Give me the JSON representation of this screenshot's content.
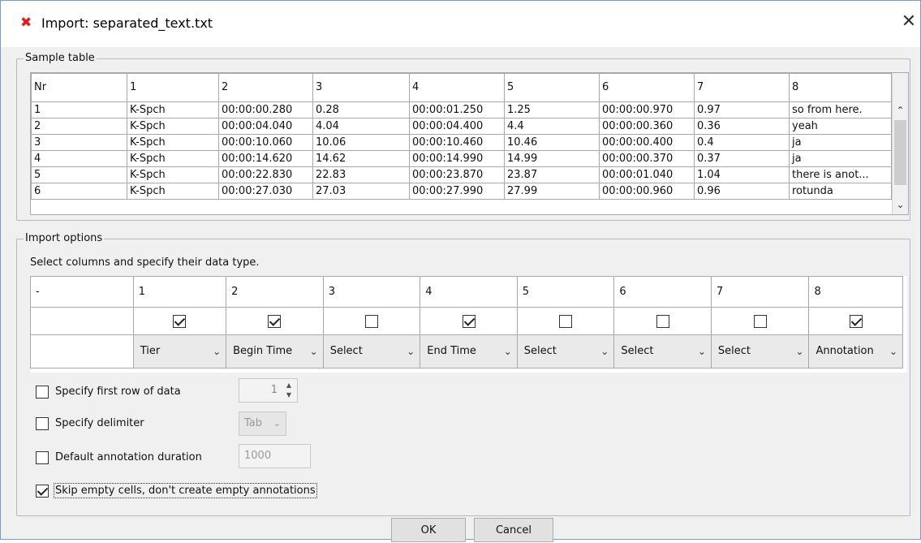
{
  "window": {
    "title": "Import: separated_text.txt"
  },
  "sample": {
    "group_label": "Sample table",
    "headers": [
      "Nr",
      "1",
      "2",
      "3",
      "4",
      "5",
      "6",
      "7",
      "8"
    ],
    "rows": [
      [
        "1",
        "K-Spch",
        "00:00:00.280",
        "0.28",
        "00:00:01.250",
        "1.25",
        "00:00:00.970",
        "0.97",
        "so from here."
      ],
      [
        "2",
        "K-Spch",
        "00:00:04.040",
        "4.04",
        "00:00:04.400",
        "4.4",
        "00:00:00.360",
        "0.36",
        "yeah"
      ],
      [
        "3",
        "K-Spch",
        "00:00:10.060",
        "10.06",
        "00:00:10.460",
        "10.46",
        "00:00:00.400",
        "0.4",
        "ja"
      ],
      [
        "4",
        "K-Spch",
        "00:00:14.620",
        "14.62",
        "00:00:14.990",
        "14.99",
        "00:00:00.370",
        "0.37",
        "ja"
      ],
      [
        "5",
        "K-Spch",
        "00:00:22.830",
        "22.83",
        "00:00:23.870",
        "23.87",
        "00:00:01.040",
        "1.04",
        "there is anot..."
      ],
      [
        "6",
        "K-Spch",
        "00:00:27.030",
        "27.03",
        "00:00:27.990",
        "27.99",
        "00:00:00.960",
        "0.96",
        "rotunda"
      ]
    ]
  },
  "options": {
    "group_label": "Import options",
    "instruction": "Select columns and specify their data type.",
    "headers": [
      "-",
      "1",
      "2",
      "3",
      "4",
      "5",
      "6",
      "7",
      "8"
    ],
    "checked": [
      true,
      true,
      false,
      true,
      false,
      false,
      false,
      true
    ],
    "types": [
      "Tier",
      "Begin Time",
      "Select",
      "End Time",
      "Select",
      "Select",
      "Select",
      "Annotation"
    ],
    "first_row_label": "Specify first row of data",
    "first_row_value": "1",
    "delimiter_label": "Specify delimiter",
    "delimiter_value": "Tab",
    "duration_label": "Default annotation duration",
    "duration_value": "1000",
    "skip_label": "Skip empty cells, don't create empty annotations",
    "skip_checked": true
  },
  "buttons": {
    "ok": "OK",
    "cancel": "Cancel"
  }
}
